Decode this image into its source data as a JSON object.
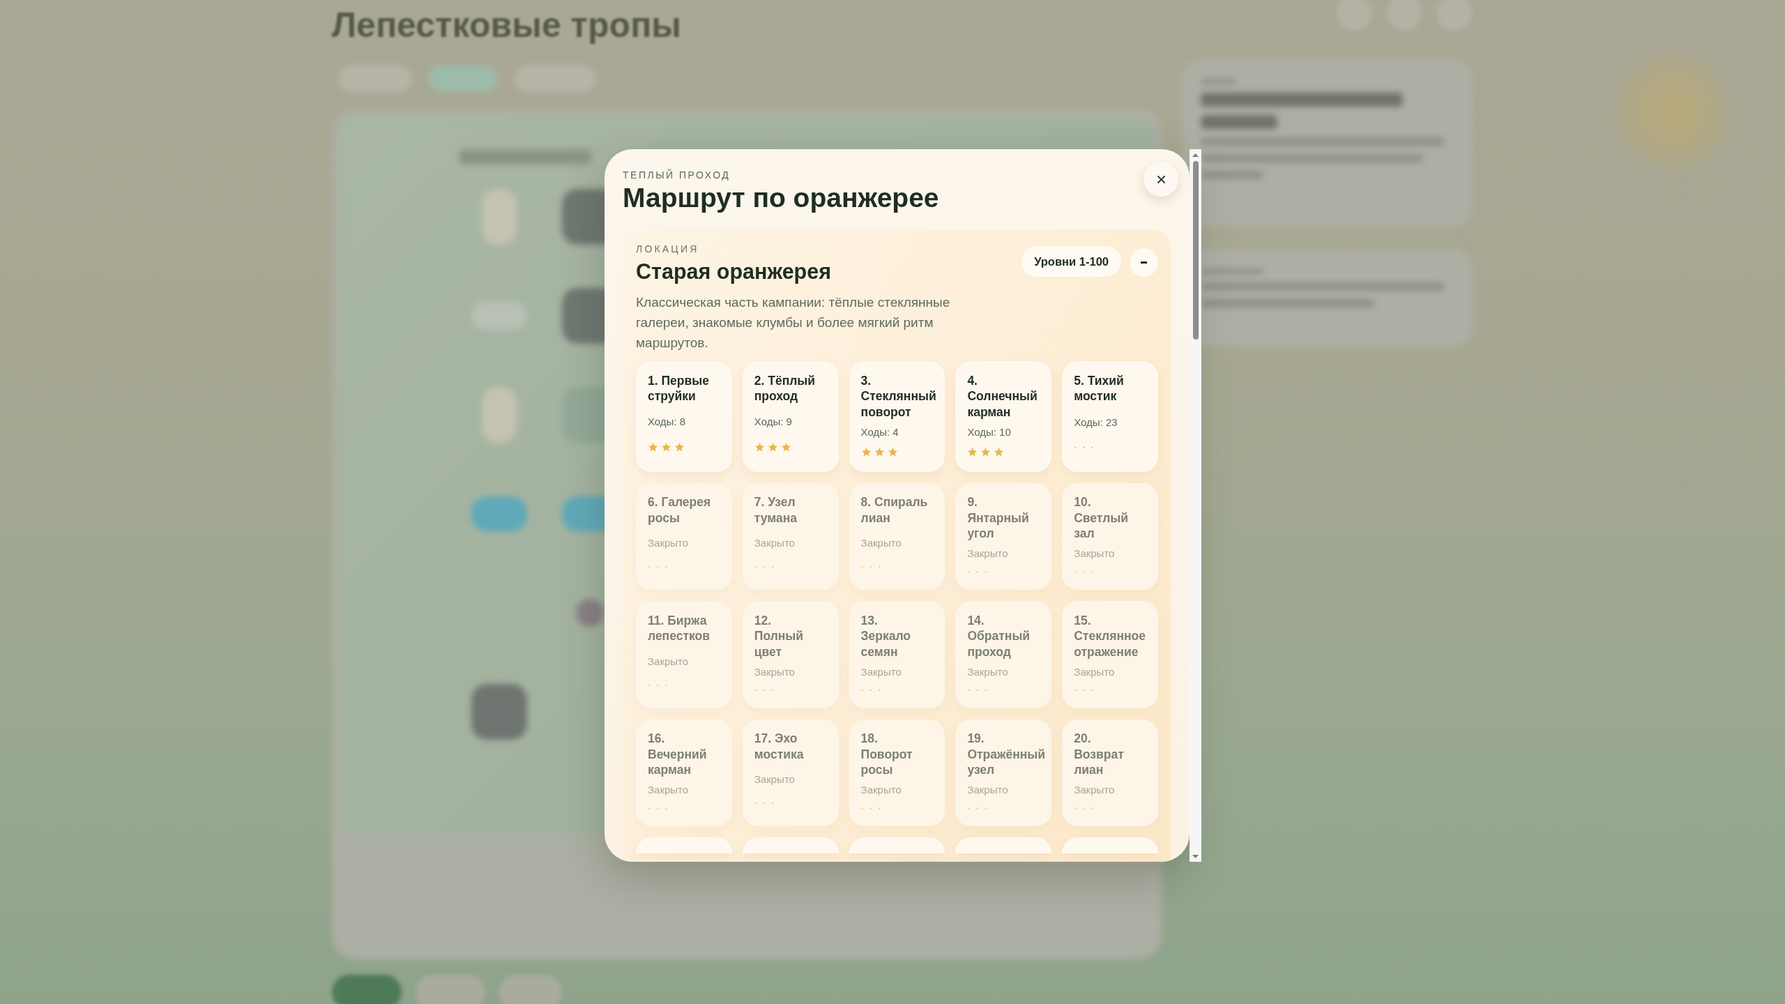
{
  "backdrop": {
    "title": "Лепестковые тропы"
  },
  "modal": {
    "eyebrow": "ТЕПЛЫЙ ПРОХОД",
    "title": "Маршрут по оранжерее"
  },
  "location": {
    "eyebrow": "ЛОКАЦИЯ",
    "title": "Старая оранжерея",
    "description": "Классическая часть кампании: тёплые стеклянные галереи, знакомые клумбы и более мягкий ритм маршрутов.",
    "range": "Уровни 1-100",
    "expanded": true
  },
  "levels": [
    {
      "title": "1. Первые струйки",
      "status": "Ходы: 8",
      "locked": false,
      "stars": 3
    },
    {
      "title": "2. Тёплый проход",
      "status": "Ходы: 9",
      "locked": false,
      "stars": 3
    },
    {
      "title": "3. Стеклянный поворот",
      "status": "Ходы: 4",
      "locked": false,
      "stars": 3
    },
    {
      "title": "4. Солнечный карман",
      "status": "Ходы: 10",
      "locked": false,
      "stars": 3
    },
    {
      "title": "5. Тихий мостик",
      "status": "Ходы: 23",
      "locked": false,
      "rating": "· · ·"
    },
    {
      "title": "6. Галерея росы",
      "status": "Закрыто",
      "locked": true,
      "rating": "· · ·"
    },
    {
      "title": "7. Узел тумана",
      "status": "Закрыто",
      "locked": true,
      "rating": "· · ·"
    },
    {
      "title": "8. Спираль лиан",
      "status": "Закрыто",
      "locked": true,
      "rating": "· · ·"
    },
    {
      "title": "9. Янтарный угол",
      "status": "Закрыто",
      "locked": true,
      "rating": "· · ·"
    },
    {
      "title": "10. Светлый зал",
      "status": "Закрыто",
      "locked": true,
      "rating": "· · ·"
    },
    {
      "title": "11. Биржа лепестков",
      "status": "Закрыто",
      "locked": true,
      "rating": "· · ·"
    },
    {
      "title": "12. Полный цвет",
      "status": "Закрыто",
      "locked": true,
      "rating": "· · ·"
    },
    {
      "title": "13. Зеркало семян",
      "status": "Закрыто",
      "locked": true,
      "rating": "· · ·"
    },
    {
      "title": "14. Обратный проход",
      "status": "Закрыто",
      "locked": true,
      "rating": "· · ·"
    },
    {
      "title": "15. Стеклянное отражение",
      "status": "Закрыто",
      "locked": true,
      "rating": "· · ·"
    },
    {
      "title": "16. Вечерний карман",
      "status": "Закрыто",
      "locked": true,
      "rating": "· · ·"
    },
    {
      "title": "17. Эхо мостика",
      "status": "Закрыто",
      "locked": true,
      "rating": "· · ·"
    },
    {
      "title": "18. Поворот росы",
      "status": "Закрыто",
      "locked": true,
      "rating": "· · ·"
    },
    {
      "title": "19. Отражённый узел",
      "status": "Закрыто",
      "locked": true,
      "rating": "· · ·"
    },
    {
      "title": "20. Возврат лиан",
      "status": "Закрыто",
      "locked": true,
      "rating": "· · ·"
    }
  ]
}
